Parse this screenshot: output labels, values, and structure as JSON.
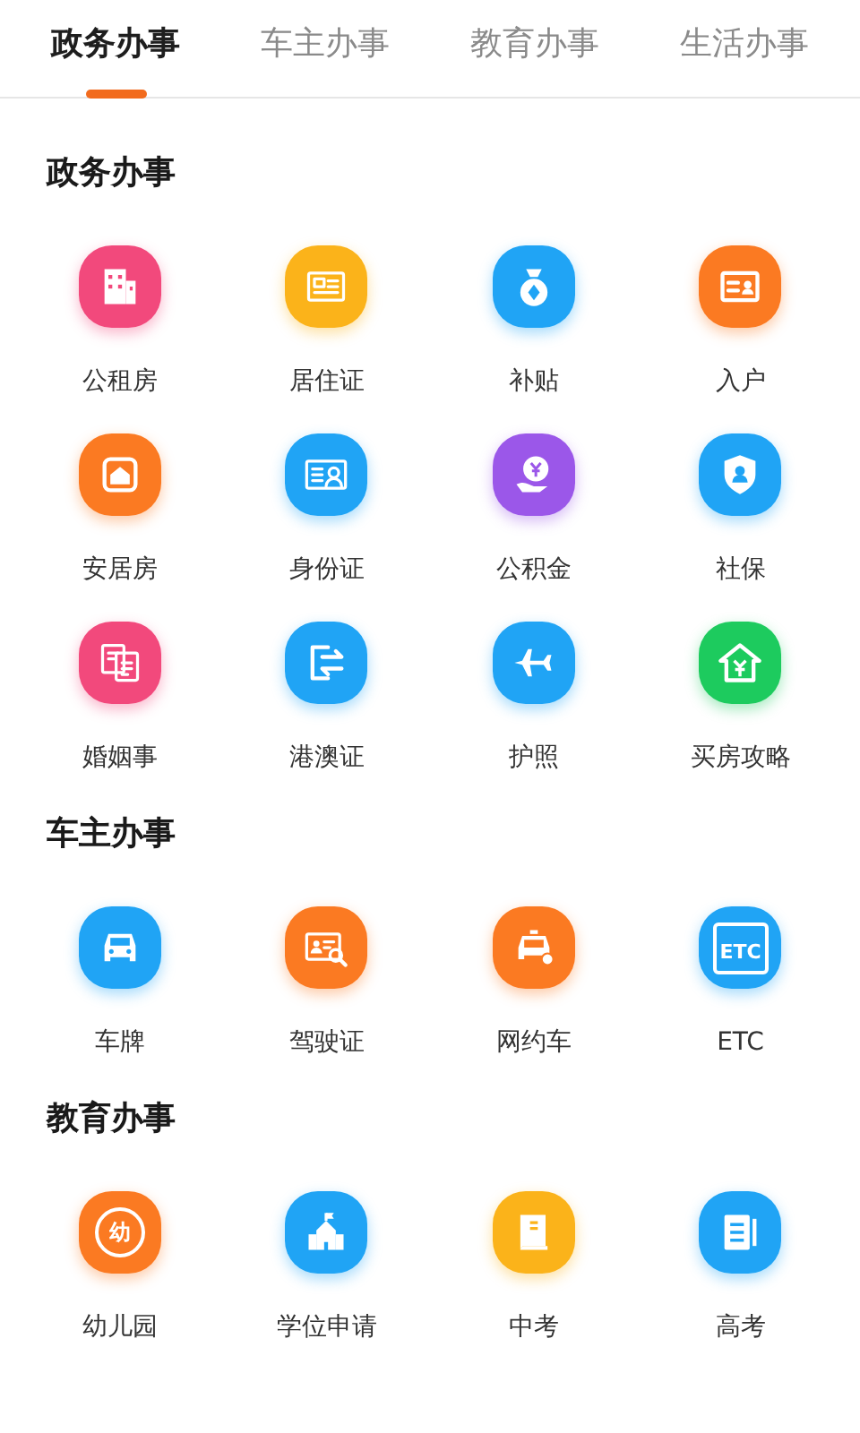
{
  "tabs": [
    {
      "label": "政务办事",
      "selected": true
    },
    {
      "label": "车主办事",
      "selected": false
    },
    {
      "label": "教育办事",
      "selected": false
    },
    {
      "label": "生活办事",
      "selected": false
    }
  ],
  "sections": [
    {
      "title": "政务办事",
      "items": [
        {
          "label": "公租房",
          "kind": "building",
          "color": "#f2497c"
        },
        {
          "label": "居住证",
          "kind": "card",
          "color": "#fbb31a"
        },
        {
          "label": "补贴",
          "kind": "moneybag",
          "color": "#20a4f5"
        },
        {
          "label": "入户",
          "kind": "idcard",
          "color": "#fb7a22"
        },
        {
          "label": "安居房",
          "kind": "house",
          "color": "#fb7a22"
        },
        {
          "label": "身份证",
          "kind": "idphoto",
          "color": "#20a4f5"
        },
        {
          "label": "公积金",
          "kind": "yenhand",
          "color": "#9b57e9"
        },
        {
          "label": "社保",
          "kind": "shield",
          "color": "#20a4f5"
        },
        {
          "label": "婚姻事",
          "kind": "certs",
          "color": "#f2497c"
        },
        {
          "label": "港澳证",
          "kind": "exit",
          "color": "#20a4f5"
        },
        {
          "label": "护照",
          "kind": "plane",
          "color": "#20a4f5"
        },
        {
          "label": "买房攻略",
          "kind": "houseyen",
          "color": "#1dcb5e"
        }
      ]
    },
    {
      "title": "车主办事",
      "items": [
        {
          "label": "车牌",
          "kind": "car",
          "color": "#20a4f5"
        },
        {
          "label": "驾驶证",
          "kind": "license",
          "color": "#fb7a22"
        },
        {
          "label": "网约车",
          "kind": "taxi",
          "color": "#fb7a22"
        },
        {
          "label": "ETC",
          "kind": "etc",
          "icon_text": "ETC",
          "color": "#20a4f5"
        }
      ]
    },
    {
      "title": "教育办事",
      "items": [
        {
          "label": "幼儿园",
          "kind": "kinder",
          "icon_text": "幼",
          "color": "#fb7a22"
        },
        {
          "label": "学位申请",
          "kind": "school",
          "color": "#20a4f5"
        },
        {
          "label": "中考",
          "kind": "book",
          "color": "#fbb31a"
        },
        {
          "label": "高考",
          "kind": "doc",
          "color": "#20a4f5"
        }
      ]
    }
  ]
}
